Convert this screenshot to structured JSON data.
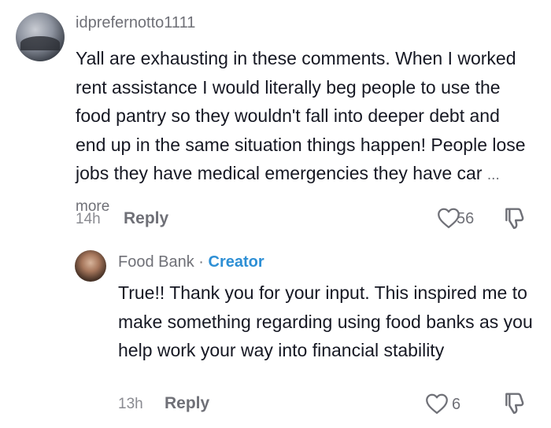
{
  "comment": {
    "username": "idprefernotto1111",
    "text": "Yall are exhausting in these comments. When I worked rent assistance I would literally beg people to use the food pantry so they wouldn't fall into deeper debt and end up in the same situation things happen! People lose jobs they have medical emergencies they have car",
    "more_label": "... more",
    "time": "14h",
    "reply_label": "Reply",
    "like_count": "56"
  },
  "reply": {
    "username": "Food Bank",
    "separator": "·",
    "badge": "Creator",
    "text": "True!! Thank you for your input. This inspired me to make something regarding using food banks as you help work your way into financial stability",
    "time": "13h",
    "reply_label": "Reply",
    "like_count": "6"
  }
}
